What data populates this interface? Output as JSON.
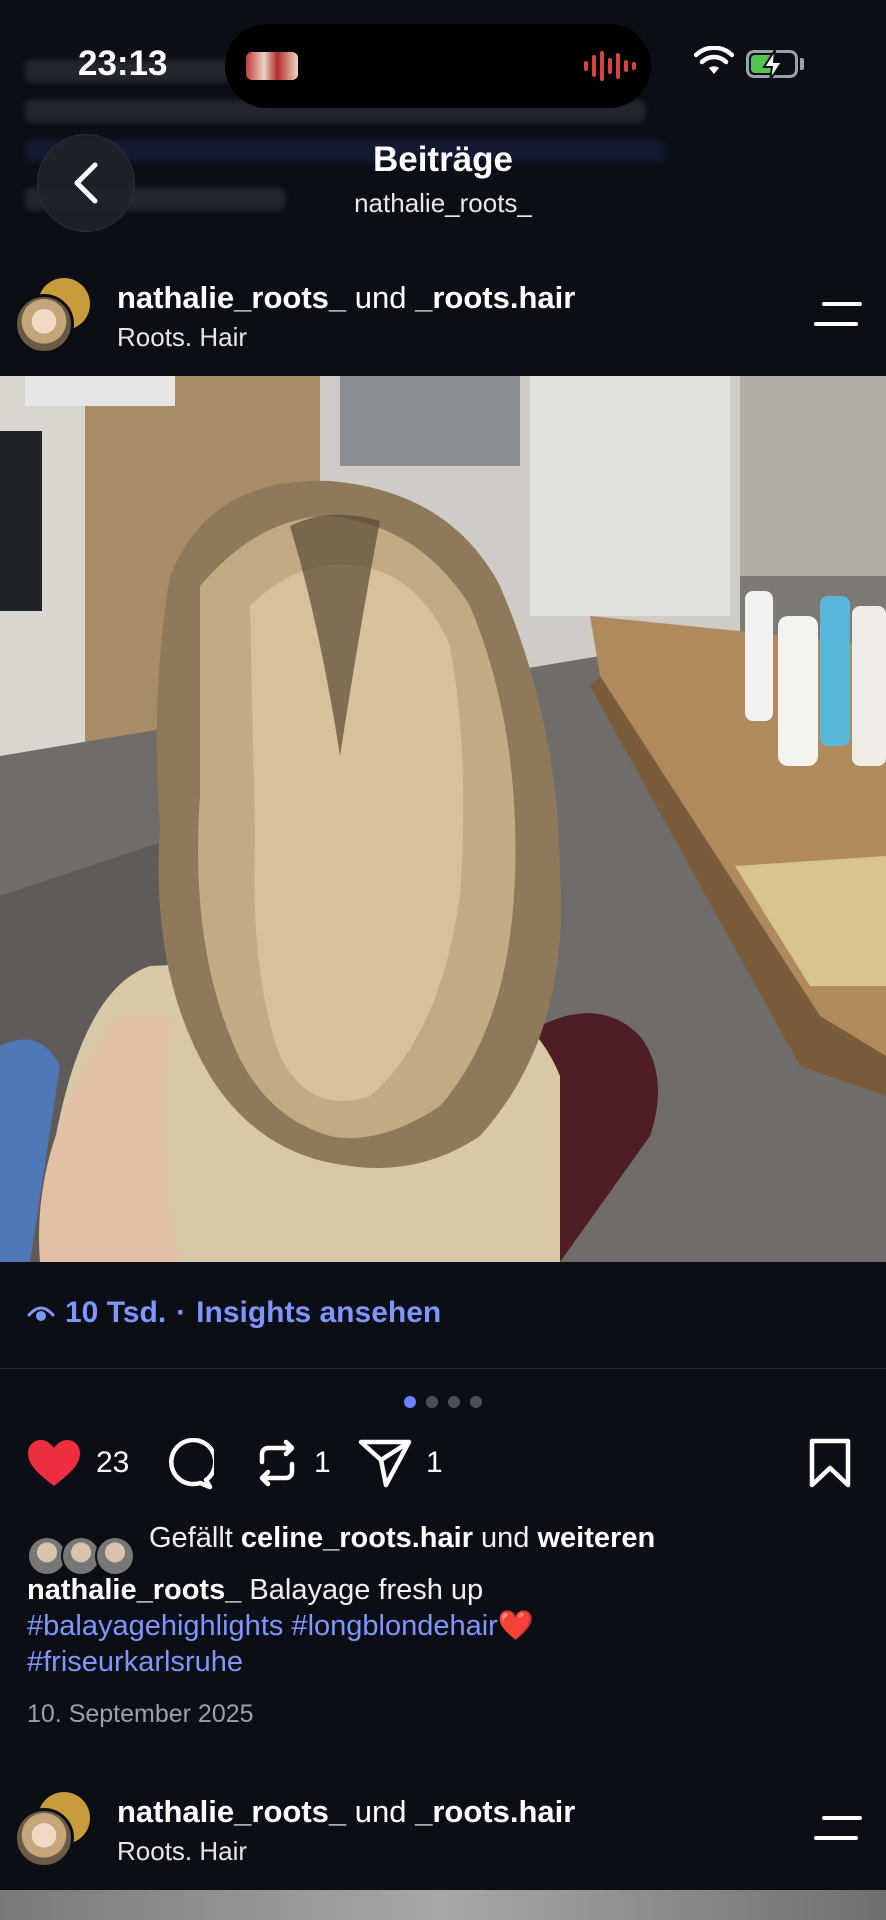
{
  "status_bar": {
    "time": "23:13",
    "battery_level": 0.55
  },
  "header": {
    "title": "Beiträge",
    "subtitle": "nathalie_roots_"
  },
  "posts": [
    {
      "user": "nathalie_roots_",
      "joiner": "und",
      "collab": "_roots.hair",
      "location": "Roots. Hair",
      "views": "10 Tsd.",
      "insights_link": "Insights ansehen",
      "carousel_count": 4,
      "carousel_active": 1,
      "likes_count": "23",
      "reposts_count": "1",
      "shares_count": "1",
      "liked_by_prefix": "Gefällt",
      "liked_by_user": "celine_roots.hair",
      "liked_by_mid": "und",
      "liked_by_suffix": "weiteren",
      "caption_user": "nathalie_roots_",
      "caption_text": "Balayage fresh up",
      "hashtags": [
        "#balayagehighlights",
        "#longblondehair",
        "#friseurkarlsruhe"
      ],
      "caption_emoji": "❤️",
      "date": "10. September 2025"
    },
    {
      "user": "nathalie_roots_",
      "joiner": "und",
      "collab": "_roots.hair",
      "location": "Roots. Hair"
    }
  ],
  "colors": {
    "background": "#0b0e14",
    "accent": "#7f95ff",
    "like": "#ed2d40",
    "battery": "#55c453"
  }
}
